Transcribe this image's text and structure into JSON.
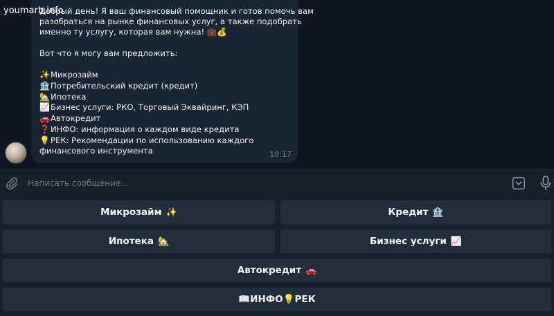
{
  "watermark": "youmarb.info",
  "message": {
    "lines": [
      {
        "emoji": "",
        "text": "Добрый день! Я ваш финансовый помощник и готов помочь вам"
      },
      {
        "emoji": "",
        "text": "разобраться на рынке финансовых услуг, а также подобрать"
      },
      {
        "emoji": "",
        "text": "именно ту услугу, которая вам нужна! 💼💰"
      },
      {
        "emoji": "",
        "text": ""
      },
      {
        "emoji": "",
        "text": "Вот что я могу вам предложить:"
      },
      {
        "emoji": "",
        "text": ""
      },
      {
        "emoji": "✨",
        "text": "Микрозайм"
      },
      {
        "emoji": "🏦",
        "text": "Потребительский кредит (кредит)"
      },
      {
        "emoji": "🏡",
        "text": "Ипотека"
      },
      {
        "emoji": "📈",
        "text": "Бизнес услуги: РКО, Торговый Эквайринг, КЭП"
      },
      {
        "emoji": "🚗",
        "text": "Автокредит"
      },
      {
        "emoji": "❓",
        "text": "ИНФО: информация о каждом виде кредита"
      },
      {
        "emoji": "💡",
        "text": "РЕК: Рекомендации по использованию каждого"
      },
      {
        "emoji": "",
        "text": "финансового инструмента"
      }
    ],
    "time": "18:17"
  },
  "composer": {
    "placeholder": "Написать сообщение..."
  },
  "keyboard": {
    "buttons": [
      {
        "label": "Микрозайм",
        "emoji": "✨"
      },
      {
        "label": "Кредит",
        "emoji": "🏦"
      },
      {
        "label": "Ипотека",
        "emoji": "🏡"
      },
      {
        "label": "Бизнес услуги",
        "emoji": "📈"
      },
      {
        "label": "Автокредит",
        "emoji": "🚗"
      },
      {
        "label": "📖ИНФО💡РЕК",
        "emoji": ""
      }
    ]
  },
  "icons": {
    "attach": "paperclip-icon",
    "keyboard_toggle": "keyboard-toggle-icon",
    "mic": "microphone-icon"
  },
  "colors": {
    "background": "#0e1621",
    "bubble": "#182533",
    "panel": "#17212b",
    "button": "#232e3c",
    "muted": "#6c7883"
  }
}
